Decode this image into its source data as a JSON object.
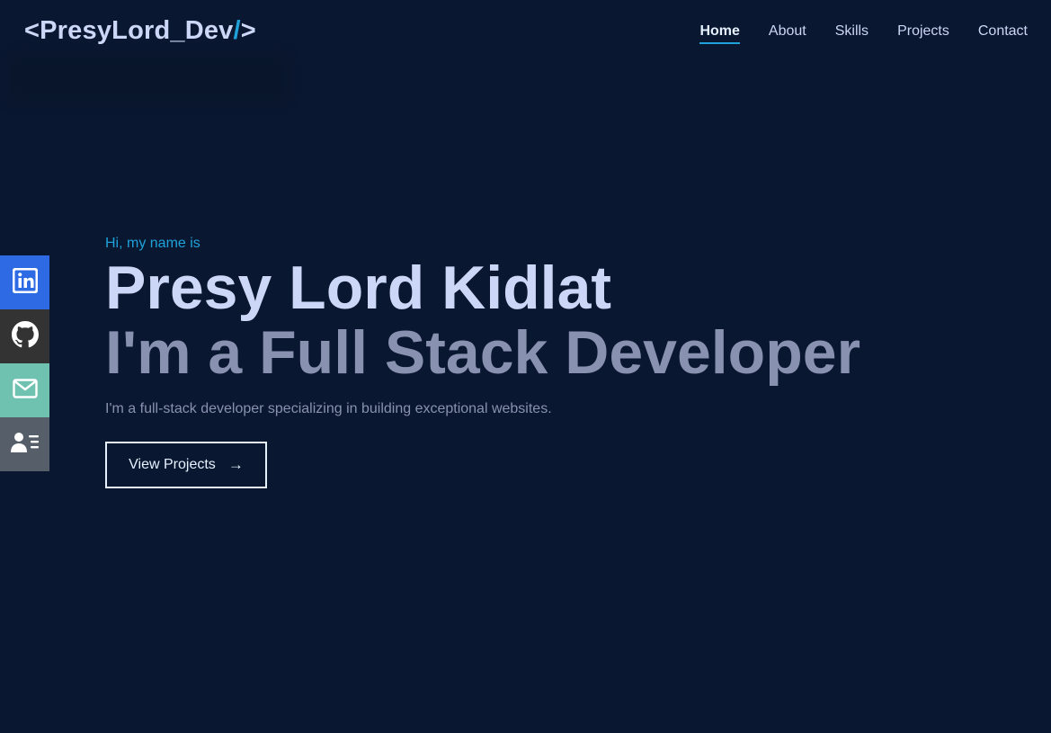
{
  "header": {
    "logo_open": "<PresyLord_Dev",
    "logo_slash": "/",
    "logo_close": ">",
    "nav": [
      {
        "label": "Home",
        "active": true
      },
      {
        "label": "About"
      },
      {
        "label": "Skills"
      },
      {
        "label": "Projects"
      },
      {
        "label": "Contact"
      }
    ]
  },
  "social": [
    {
      "icon": "linkedin-icon",
      "color": "#2d6ae3"
    },
    {
      "icon": "github-icon",
      "color": "#333333"
    },
    {
      "icon": "mail-icon",
      "color": "#6fc2b0"
    },
    {
      "icon": "resume-icon",
      "color": "#565f69"
    }
  ],
  "hero": {
    "greeting": "Hi, my name is",
    "name": "Presy Lord Kidlat",
    "role": "I'm a Full Stack Developer",
    "description": "I'm a full-stack developer specializing in building exceptional websites.",
    "cta_label": "View Projects",
    "cta_arrow": "→"
  },
  "colors": {
    "background": "#0a1730",
    "accent": "#1ea2d9",
    "heading": "#ccd6f6",
    "muted": "#8892b0"
  }
}
